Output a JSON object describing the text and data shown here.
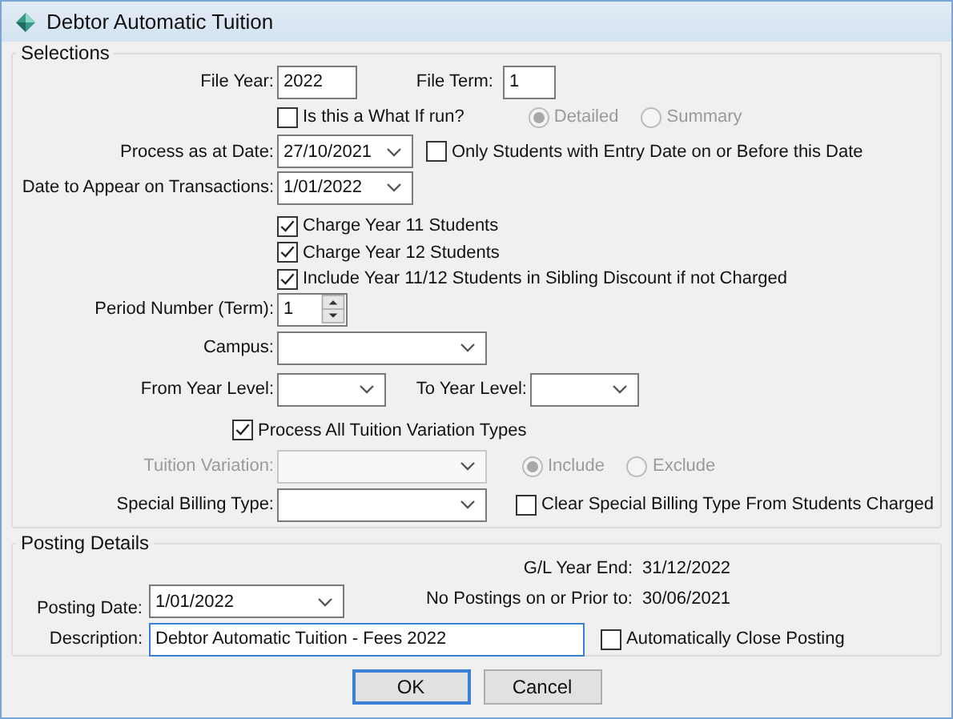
{
  "window": {
    "title": "Debtor Automatic Tuition"
  },
  "selections": {
    "legend": "Selections",
    "file_year": {
      "label": "File Year:",
      "value": "2022"
    },
    "file_term": {
      "label": "File Term:",
      "value": "1"
    },
    "what_if": {
      "label": "Is this a What If run?",
      "checked": false
    },
    "report_type": [
      {
        "label": "Detailed",
        "selected": true,
        "disabled": true
      },
      {
        "label": "Summary",
        "selected": false,
        "disabled": true
      }
    ],
    "process_date": {
      "label": "Process as at Date:",
      "value": "27/10/2021"
    },
    "only_students": {
      "label": "Only Students with  Entry Date on or Before this Date",
      "checked": false
    },
    "transaction_date": {
      "label": "Date to Appear on Transactions:",
      "value": "1/01/2022"
    },
    "charge_options": [
      {
        "label": "Charge Year 11 Students",
        "checked": true
      },
      {
        "label": "Charge Year 12 Students",
        "checked": true
      },
      {
        "label": "Include Year 11/12 Students in Sibling Discount if not Charged",
        "checked": true
      }
    ],
    "period_number": {
      "label": "Period Number (Term):",
      "value": "1"
    },
    "campus": {
      "label": "Campus:"
    },
    "from_year_level": {
      "label": "From Year Level:"
    },
    "to_year_level": {
      "label": "To Year Level:"
    },
    "process_all": {
      "label": "Process All Tuition Variation Types",
      "checked": true
    },
    "tuition_variation": {
      "label": "Tuition Variation:",
      "disabled": true
    },
    "variation_mode": [
      {
        "label": "Include",
        "selected": true,
        "disabled": true
      },
      {
        "label": "Exclude",
        "selected": false,
        "disabled": true
      }
    ],
    "special_billing": {
      "label": "Special Billing Type:"
    },
    "clear_special": {
      "label": "Clear Special Billing Type From Students Charged",
      "checked": false
    }
  },
  "posting": {
    "legend": "Posting  Details",
    "posting_date": {
      "label": "Posting Date:",
      "value": "1/01/2022"
    },
    "gl_year_end": {
      "label": "G/L Year End:",
      "value": "31/12/2022"
    },
    "no_postings": {
      "label": "No Postings on or Prior to:",
      "value": "30/06/2021"
    },
    "description": {
      "label": "Description:",
      "value": "Debtor Automatic Tuition - Fees 2022",
      "focused": true
    },
    "auto_close": {
      "label": "Automatically Close Posting",
      "checked": false
    }
  },
  "buttons": [
    {
      "label": "OK",
      "default": true
    },
    {
      "label": "Cancel",
      "default": false
    }
  ]
}
